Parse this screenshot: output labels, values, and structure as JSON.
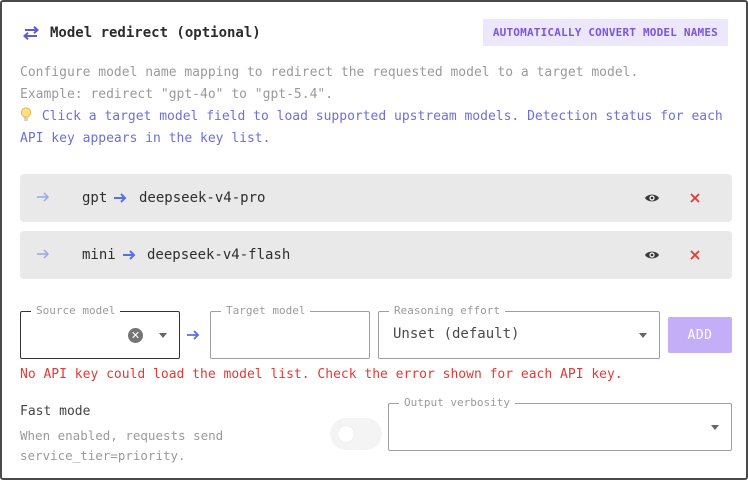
{
  "header": {
    "title": "Model redirect (optional)",
    "badge": "AUTOMATICALLY CONVERT MODEL NAMES",
    "icon": "swap-arrows-icon"
  },
  "description": {
    "line1": "Configure model name mapping to redirect the requested model to a target model.",
    "line2": "Example: redirect \"gpt-4o\" to \"gpt-5.4\"."
  },
  "tip": {
    "icon": "lightbulb-icon",
    "text": "Click a target model field to load supported upstream models. Detection status for each API key appears in the key list."
  },
  "mappings": [
    {
      "source": "gpt",
      "target": "deepseek-v4-pro"
    },
    {
      "source": "mini",
      "target": "deepseek-v4-flash"
    }
  ],
  "form": {
    "source_model": {
      "label": "Source model",
      "value": ""
    },
    "target_model": {
      "label": "Target model",
      "value": ""
    },
    "reasoning_effort": {
      "label": "Reasoning effort",
      "value": "Unset (default)"
    },
    "add_button": "ADD"
  },
  "error": "No API key could load the model list. Check the error shown for each API key.",
  "fast_mode": {
    "label": "Fast mode",
    "help": "When enabled, requests send service_tier=priority.",
    "enabled": false
  },
  "output_verbosity": {
    "label": "Output verbosity",
    "value": ""
  },
  "colors": {
    "accent": "#7b55e0",
    "badge_bg": "#ede7fb",
    "error": "#e53935",
    "tip": "#6e6ee0",
    "add_button_bg": "#c4aef7"
  }
}
